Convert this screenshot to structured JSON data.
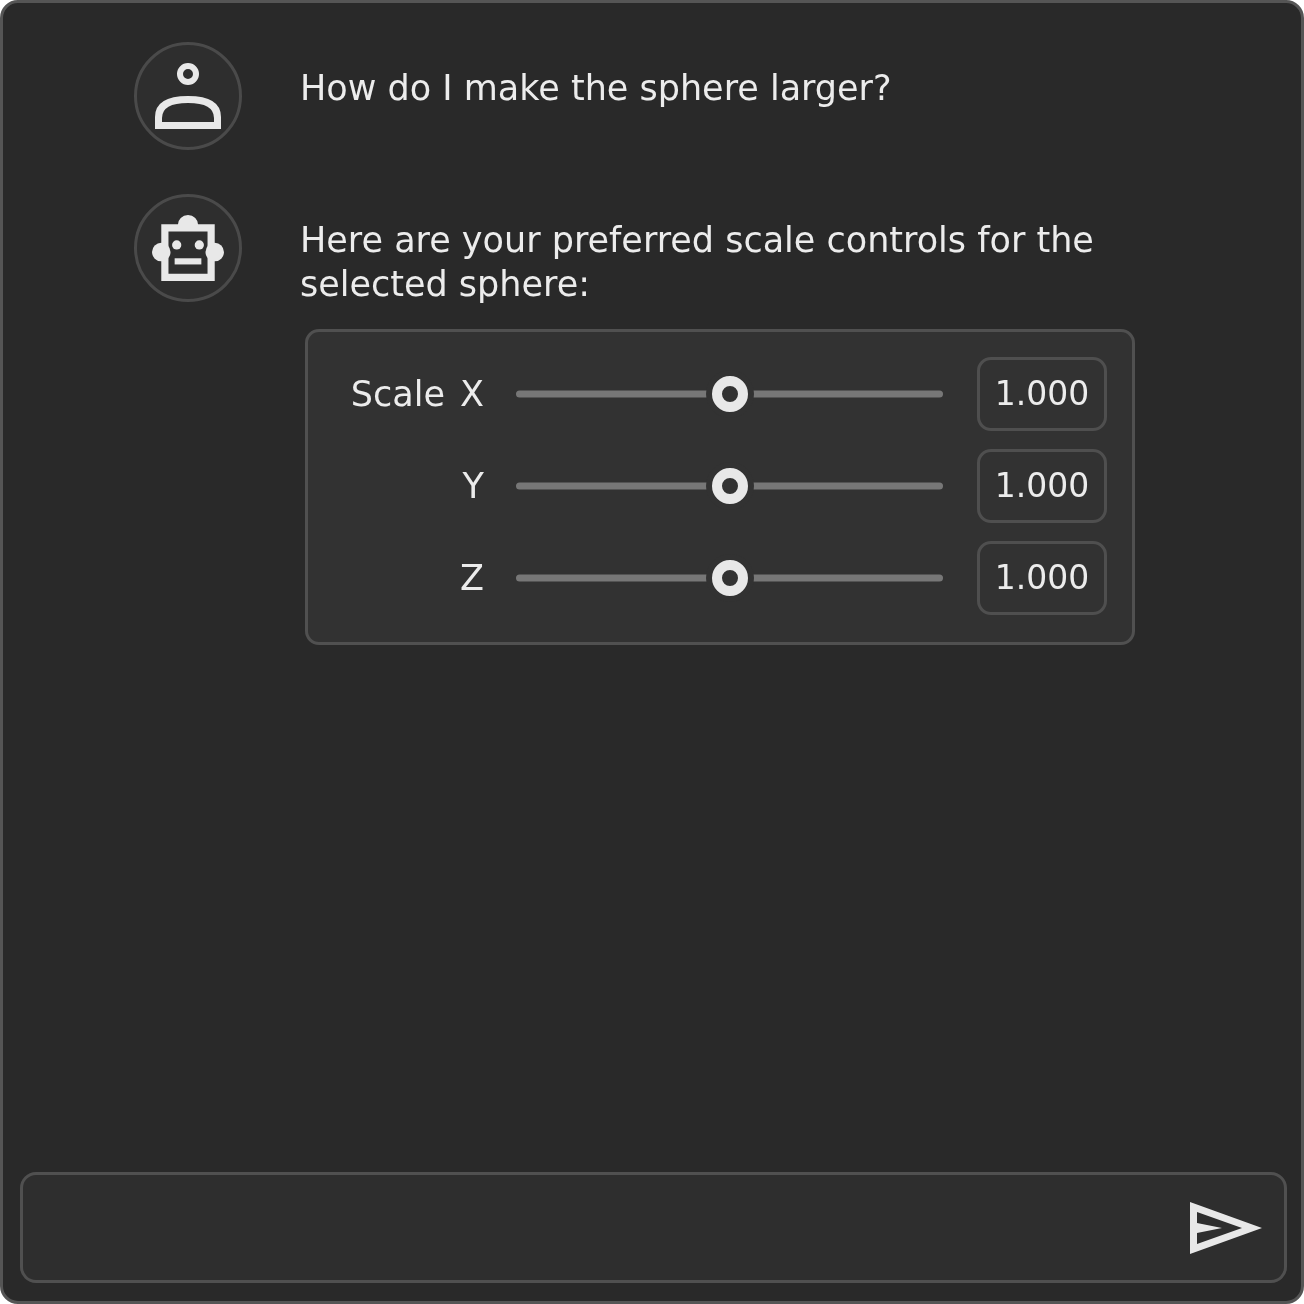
{
  "messages": [
    {
      "kind": "user",
      "text": "How do I make the sphere larger?"
    },
    {
      "kind": "assistant",
      "text": "Here are your preferred scale controls for the selected sphere:",
      "controls": {
        "title": "Scale",
        "rows": [
          {
            "axis": "X",
            "level": 0.5,
            "value": "1.000"
          },
          {
            "axis": "Y",
            "level": 0.5,
            "value": "1.000"
          },
          {
            "axis": "Z",
            "level": 0.5,
            "value": "1.000"
          }
        ]
      }
    }
  ]
}
